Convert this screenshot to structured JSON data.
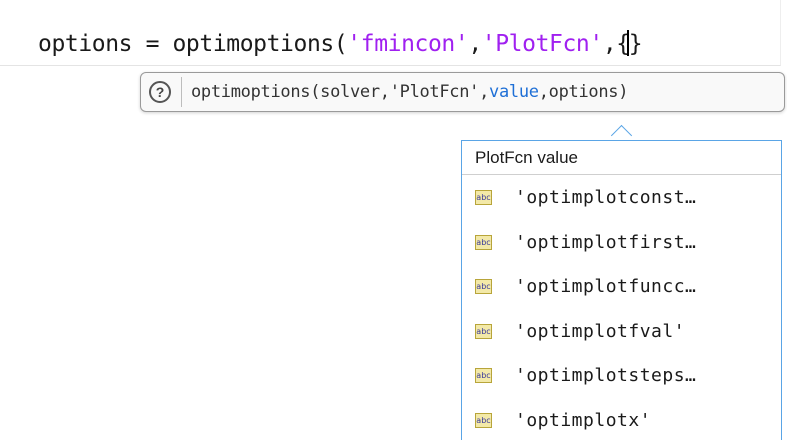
{
  "editor": {
    "code_prefix": "options = optimoptions(",
    "code_arg1": "'fmincon'",
    "code_sep1": ",",
    "code_arg2": "'PlotFcn'",
    "code_sep2": ",{",
    "code_suffix": "}"
  },
  "signature_tip": {
    "help_icon": "question-mark-circle",
    "help_glyph": "?",
    "sig_prefix": "optimoptions(solver,'PlotFcn',",
    "sig_current_arg": "value",
    "sig_suffix": ",options)",
    "highlight_color": "#1e6fd6"
  },
  "completion_popup": {
    "header": "PlotFcn value",
    "item_icon": "abc-string-icon",
    "icon_text": "abc",
    "items": [
      {
        "label": "'optimplotconst…"
      },
      {
        "label": "'optimplotfirst…"
      },
      {
        "label": "'optimplotfuncc…"
      },
      {
        "label": "'optimplotfval'"
      },
      {
        "label": "'optimplotsteps…"
      },
      {
        "label": "'optimplotx'"
      }
    ],
    "border_color": "#5aa5e6"
  }
}
